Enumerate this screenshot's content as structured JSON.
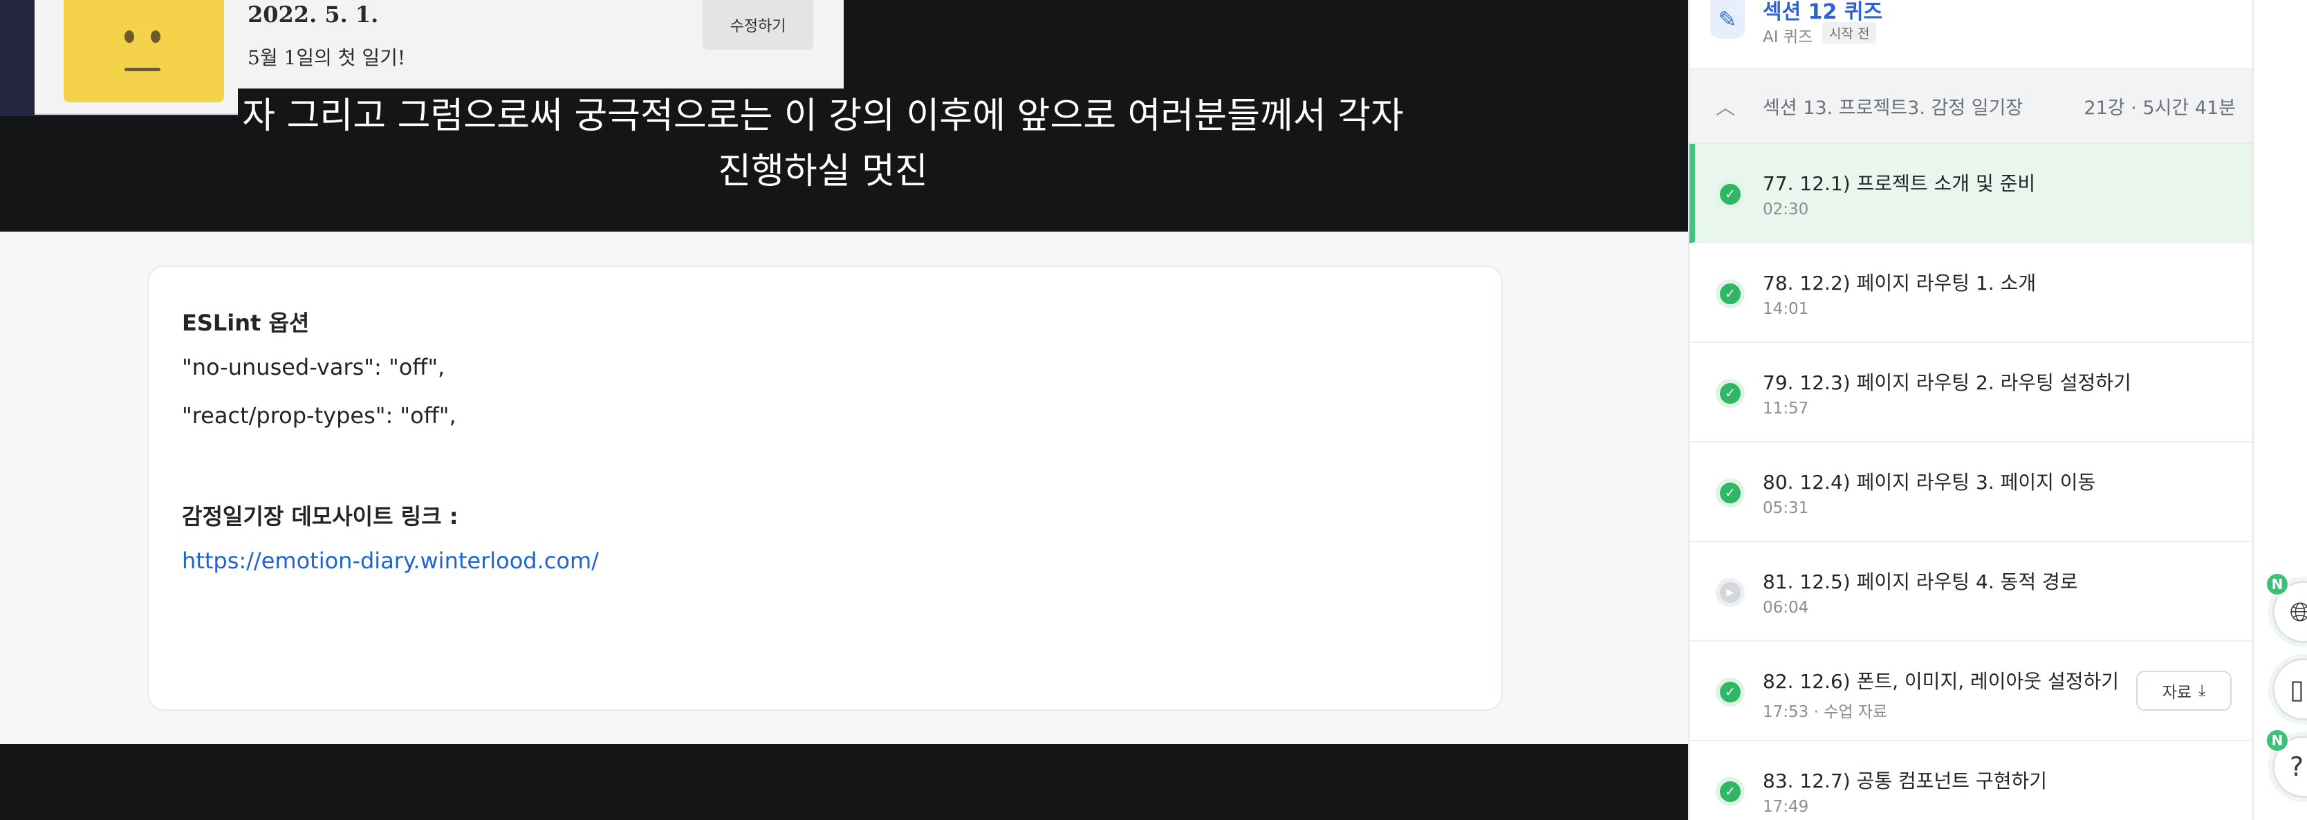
{
  "video": {
    "thumb_date": "2022. 5. 1.",
    "thumb_caption": "5월 1일의 첫 일기!",
    "thumb_edit_button": "수정하기",
    "subtitle_line1": "자 그리고 그럼으로써 궁극적으로는 이 강의 이후에 앞으로 여러분들께서 각자",
    "subtitle_line2": "진행하실 멋진"
  },
  "notes": {
    "eslint_heading": "ESLint 옵션",
    "eslint_rule1": "\"no-unused-vars\": \"off\",",
    "eslint_rule2": "\"react/prop-types\": \"off\",",
    "demo_heading": "감정일기장 데모사이트 링크 :",
    "demo_link": "https://emotion-diary.winterlood.com/"
  },
  "sidebar": {
    "quiz": {
      "title": "섹션 12 퀴즈",
      "subtitle": "AI 퀴즈",
      "badge": "시작 전"
    },
    "section": {
      "title": "섹션 13. 프로젝트3. 감정 일기장",
      "meta": "21강 · 5시간 41분"
    },
    "lectures": [
      {
        "title": "77. 12.1) 프로젝트 소개 및 준비",
        "time": "02:30",
        "status": "done",
        "active": true
      },
      {
        "title": "78. 12.2) 페이지 라우팅 1. 소개",
        "time": "14:01",
        "status": "done"
      },
      {
        "title": "79. 12.3) 페이지 라우팅 2. 라우팅 설정하기",
        "time": "11:57",
        "status": "done"
      },
      {
        "title": "80. 12.4) 페이지 라우팅 3. 페이지 이동",
        "time": "05:31",
        "status": "done"
      },
      {
        "title": "81. 12.5) 페이지 라우팅 4. 동적 경로",
        "time": "06:04",
        "status": "play"
      },
      {
        "title": "82. 12.6) 폰트, 이미지, 레이아웃 설정하기",
        "time": "17:53 · 수업 자료",
        "status": "done",
        "resource_button": "자료"
      },
      {
        "title": "83. 12.7) 공통 컴포넌트 구현하기",
        "time": "17:49",
        "status": "done"
      }
    ]
  },
  "floating": {
    "badge_new": "N",
    "globe_icon": "globe-icon",
    "tablet_icon": "tablet-icon",
    "help_label": "?"
  },
  "colors": {
    "accent_green": "#2fb765",
    "link_blue": "#1e63d6",
    "quiz_blue": "#2d62d6",
    "video_bg": "#141517"
  }
}
